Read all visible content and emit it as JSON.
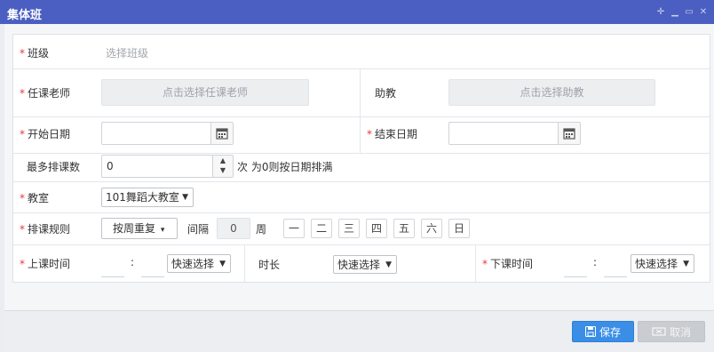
{
  "window": {
    "title": "集体班"
  },
  "form": {
    "class": {
      "label": "班级",
      "placeholder": "选择班级"
    },
    "teacher": {
      "label": "任课老师",
      "button": "点击选择任课老师"
    },
    "assistant": {
      "label": "助教",
      "button": "点击选择助教"
    },
    "start_date": {
      "label": "开始日期",
      "value": ""
    },
    "end_date": {
      "label": "结束日期",
      "value": ""
    },
    "max_sessions": {
      "label": "最多排课数",
      "value": "0",
      "unit": "次",
      "hint": "为0则按日期排满"
    },
    "classroom": {
      "label": "教室",
      "value": "101舞蹈大教室",
      "arrow": "▼"
    },
    "schedule_rule": {
      "label": "排课规则",
      "mode": "按周重复",
      "mode_arrow": "▾",
      "interval_label": "间隔",
      "interval_value": "0",
      "interval_unit": "周",
      "days": [
        "一",
        "二",
        "三",
        "四",
        "五",
        "六",
        "日"
      ]
    },
    "start_time": {
      "label": "上课时间",
      "colon": ":",
      "quick": "快速选择",
      "arrow": "▼"
    },
    "duration": {
      "label": "时长",
      "quick": "快速选择",
      "arrow": "▼"
    },
    "end_time": {
      "label": "下课时间",
      "colon": ":",
      "quick": "快速选择",
      "arrow": "▼"
    }
  },
  "required_mark": "*",
  "footer": {
    "save": "保存",
    "cancel": "取消"
  },
  "colors": {
    "titlebar": "#4a5fc1",
    "primary": "#3a8ee6",
    "required": "#e53935"
  }
}
